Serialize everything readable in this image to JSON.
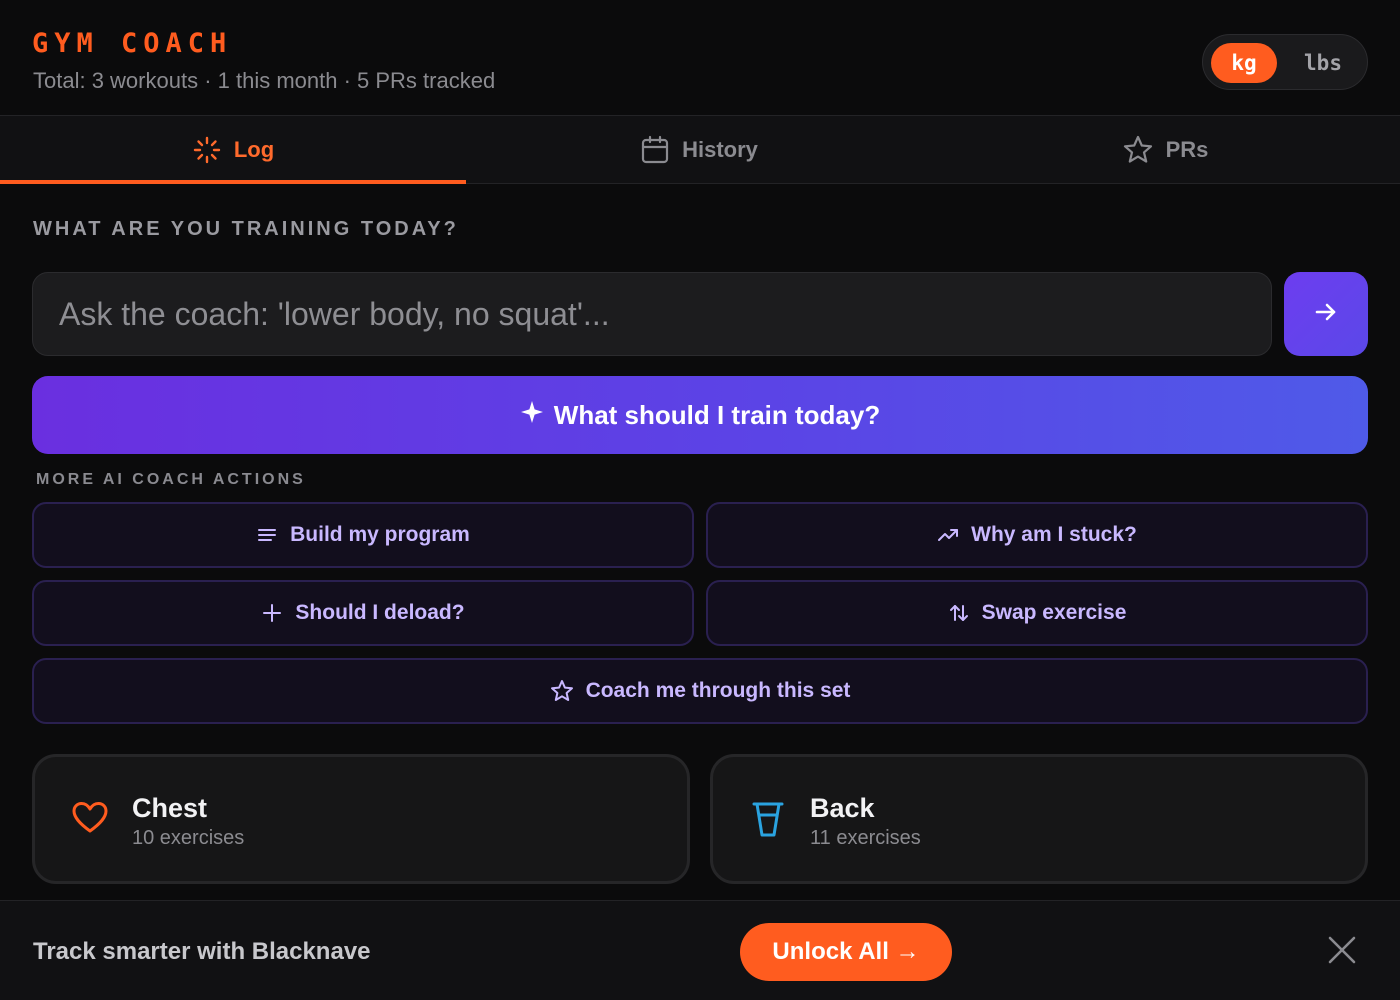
{
  "header": {
    "title": "GYM COACH",
    "subtitle": "Total: 3 workouts · 1 this month · 5 PRs tracked",
    "units": {
      "kg": "kg",
      "lbs": "lbs",
      "selected": "kg"
    }
  },
  "tabs": [
    {
      "label": "Log",
      "icon": "loader-icon",
      "active": true
    },
    {
      "label": "History",
      "icon": "calendar-icon",
      "active": false
    },
    {
      "label": "PRs",
      "icon": "star-icon",
      "active": false
    }
  ],
  "training": {
    "heading": "WHAT ARE YOU TRAINING TODAY?",
    "placeholder": "Ask the coach: 'lower body, no squat'...",
    "value": "",
    "primary_action": "What should I train today?"
  },
  "more_actions": {
    "heading": "MORE AI COACH ACTIONS",
    "items": [
      {
        "label": "Build my program",
        "icon": "lines-icon"
      },
      {
        "label": "Why am I stuck?",
        "icon": "trend-icon"
      },
      {
        "label": "Should I deload?",
        "icon": "plus-icon"
      },
      {
        "label": "Swap exercise",
        "icon": "swap-arrows-icon"
      },
      {
        "label": "Coach me through this set",
        "icon": "star-icon"
      }
    ]
  },
  "muscle_groups": [
    {
      "name": "Chest",
      "count": "10 exercises",
      "icon": "heart-icon",
      "color": "#ff5c1f"
    },
    {
      "name": "Back",
      "count": "11 exercises",
      "icon": "back-icon",
      "color": "#2aa3e0"
    }
  ],
  "promo": {
    "text": "Track smarter with Blacknave",
    "button": "Unlock All →"
  },
  "colors": {
    "accent": "#ff5c1f",
    "purple": "#6a2fe0",
    "background": "#0b0b0c"
  }
}
